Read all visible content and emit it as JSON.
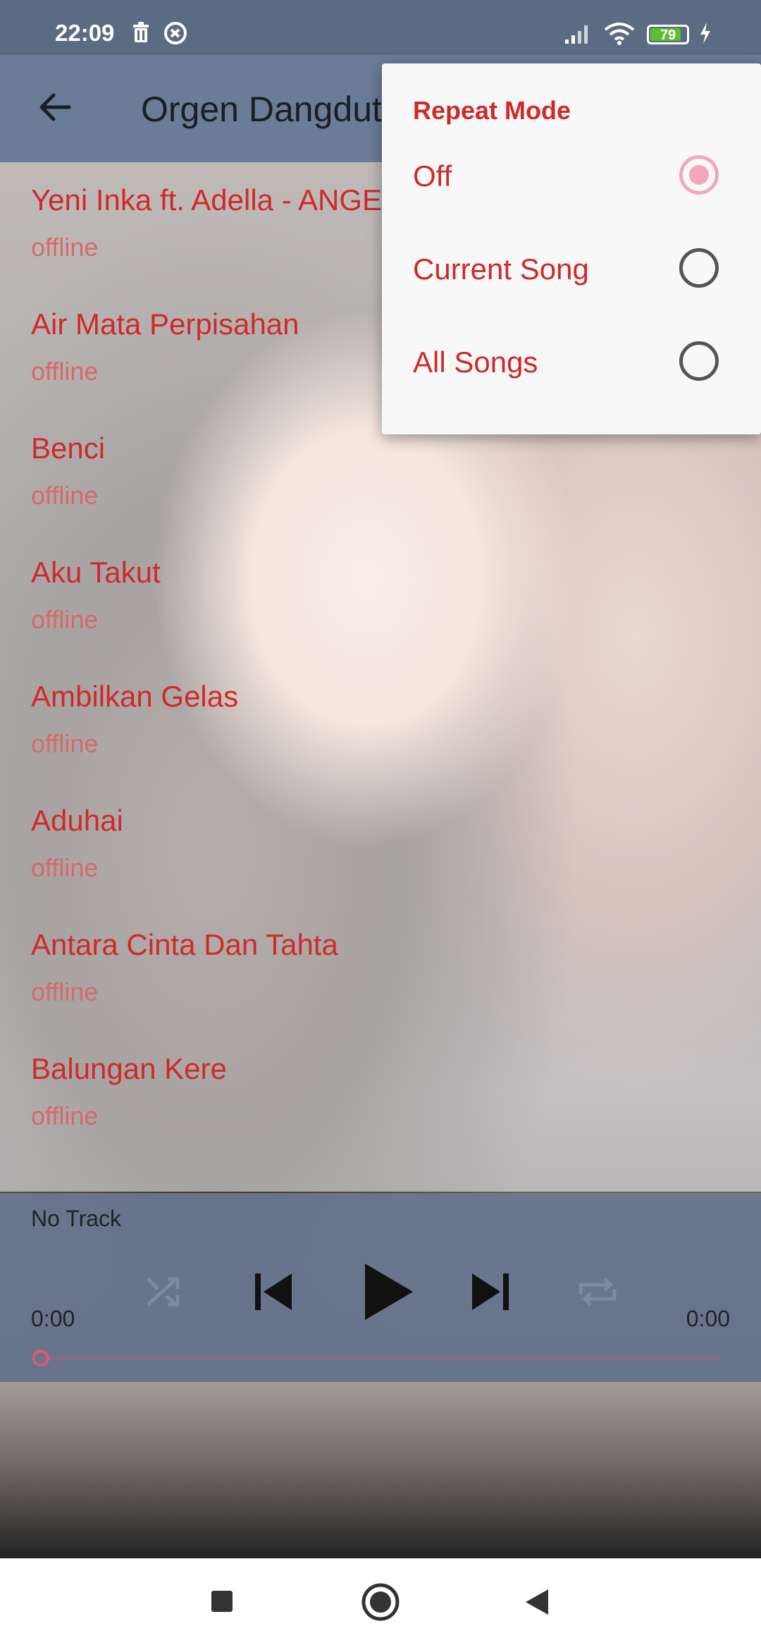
{
  "status_bar": {
    "time": "22:09",
    "battery_level": "79",
    "icons": [
      "trash-icon",
      "sync-icon",
      "signal-icon",
      "wifi-icon",
      "battery-icon",
      "charging-icon"
    ]
  },
  "app_bar": {
    "title": "Orgen Dangdut",
    "back_icon": "arrow-left-icon"
  },
  "songs": [
    {
      "title": "Yeni Inka ft. Adella - ANGEL",
      "subtitle": "offline"
    },
    {
      "title": "Air Mata Perpisahan",
      "subtitle": "offline"
    },
    {
      "title": "Benci",
      "subtitle": "offline"
    },
    {
      "title": "Aku Takut",
      "subtitle": "offline"
    },
    {
      "title": "Ambilkan Gelas",
      "subtitle": "offline"
    },
    {
      "title": "Aduhai",
      "subtitle": "offline"
    },
    {
      "title": "Antara Cinta Dan Tahta",
      "subtitle": "offline"
    },
    {
      "title": "Balungan Kere",
      "subtitle": "offline"
    }
  ],
  "player": {
    "track": "No Track",
    "time_elapsed": "0:00",
    "time_total": "0:00",
    "progress": 0,
    "controls": [
      "shuffle-icon",
      "previous-icon",
      "play-icon",
      "next-icon",
      "repeat-icon"
    ]
  },
  "repeat_menu": {
    "title": "Repeat Mode",
    "options": [
      {
        "label": "Off",
        "selected": true
      },
      {
        "label": "Current Song",
        "selected": false
      },
      {
        "label": "All Songs",
        "selected": false
      }
    ]
  },
  "colors": {
    "accent": "#cf2a2a",
    "app_bar": "#6a7c97",
    "status_bar": "#5b6b84",
    "radio_selected": "#f2a7bc"
  },
  "nav_bar": {
    "buttons": [
      "recents-icon",
      "home-icon",
      "back-icon"
    ]
  }
}
